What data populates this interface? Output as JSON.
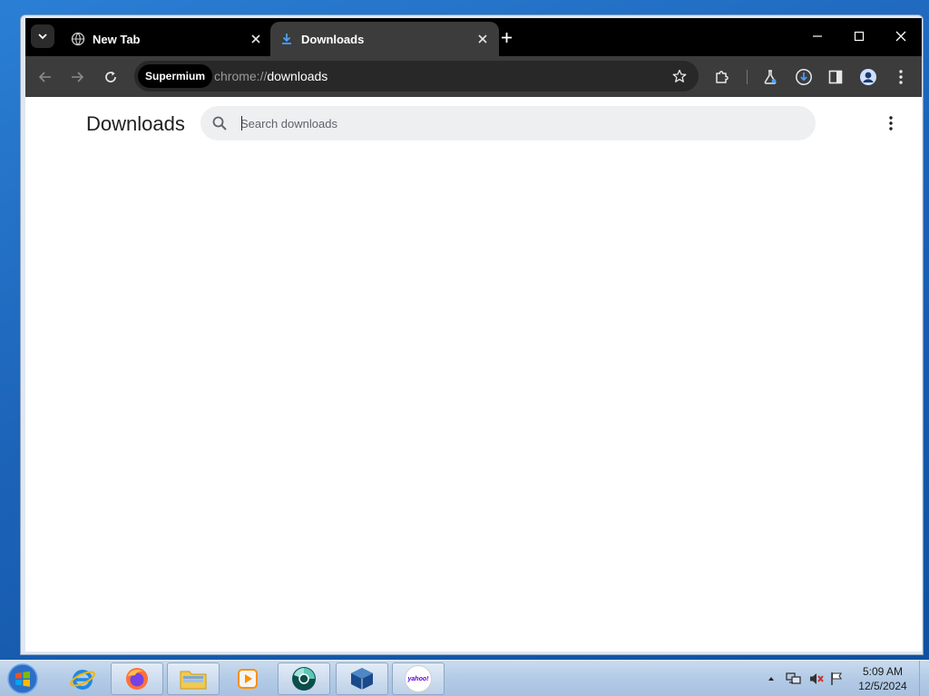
{
  "browser": {
    "tabs": [
      {
        "label": "New Tab",
        "icon": "globe-icon",
        "active": false
      },
      {
        "label": "Downloads",
        "icon": "download-icon",
        "active": true
      }
    ],
    "omnibox": {
      "chip_label": "Supermium",
      "url_scheme": "chrome://",
      "url_host": "downloads"
    }
  },
  "page": {
    "title": "Downloads",
    "search_placeholder": "Search downloads"
  },
  "taskbar": {
    "apps": [
      "internet-explorer-icon",
      "firefox-icon",
      "file-explorer-icon",
      "media-player-icon",
      "supermium-icon",
      "virtualbox-icon",
      "yahoo-icon"
    ],
    "yahoo_label": "yahoo!",
    "clock_time": "5:09 AM",
    "clock_date": "12/5/2024"
  },
  "colors": {
    "tabstrip": "#000000",
    "toolbar": "#3c3c3c",
    "omnibox": "#282828",
    "search_box": "#eeeff1"
  }
}
